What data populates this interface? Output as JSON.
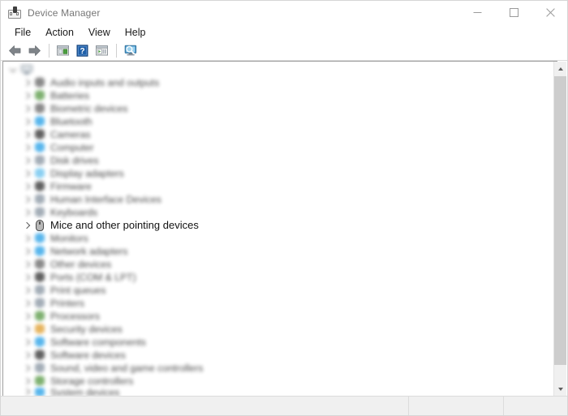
{
  "window": {
    "title": "Device Manager",
    "icon": "device-manager-icon",
    "controls": {
      "minimize": "minimize-icon",
      "maximize": "maximize-icon",
      "close": "close-icon"
    }
  },
  "menubar": {
    "items": [
      {
        "label": "File"
      },
      {
        "label": "Action"
      },
      {
        "label": "View"
      },
      {
        "label": "Help"
      }
    ]
  },
  "toolbar": {
    "buttons": [
      {
        "name": "back-icon",
        "tip": "Back"
      },
      {
        "name": "forward-icon",
        "tip": "Forward"
      },
      {
        "name": "separator-1",
        "tip": ""
      },
      {
        "name": "properties-icon",
        "tip": "Properties"
      },
      {
        "name": "help-icon",
        "tip": "Help"
      },
      {
        "name": "update-driver-icon",
        "tip": "Update driver"
      },
      {
        "name": "separator-2",
        "tip": ""
      },
      {
        "name": "scan-hardware-changes-icon",
        "tip": "Scan for hardware changes"
      }
    ]
  },
  "tree": {
    "root": {
      "label": "",
      "expanded": true,
      "icon": "computer-icon",
      "blurred": true
    },
    "nodes": [
      {
        "label": "Audio inputs and outputs",
        "icon": "audio-icon",
        "color": "gray",
        "blurred": true
      },
      {
        "label": "Batteries",
        "icon": "battery-icon",
        "color": "green",
        "blurred": true
      },
      {
        "label": "Biometric devices",
        "icon": "biometric-icon",
        "color": "gray",
        "blurred": true
      },
      {
        "label": "Bluetooth",
        "icon": "bluetooth-icon",
        "color": "blue",
        "blurred": true
      },
      {
        "label": "Cameras",
        "icon": "camera-icon",
        "color": "dark",
        "blurred": true
      },
      {
        "label": "Computer",
        "icon": "computer-node-icon",
        "color": "blue",
        "blurred": true
      },
      {
        "label": "Disk drives",
        "icon": "disk-drive-icon",
        "color": "steel",
        "blurred": true
      },
      {
        "label": "Display adapters",
        "icon": "display-adapter-icon",
        "color": "lblue",
        "blurred": true
      },
      {
        "label": "Firmware",
        "icon": "firmware-icon",
        "color": "dark",
        "blurred": true
      },
      {
        "label": "Human Interface Devices",
        "icon": "hid-icon",
        "color": "steel",
        "blurred": true
      },
      {
        "label": "Keyboards",
        "icon": "keyboard-icon",
        "color": "steel",
        "blurred": true
      },
      {
        "label": "Mice and other pointing devices",
        "icon": "mouse-icon",
        "color": "dark",
        "blurred": false
      },
      {
        "label": "Monitors",
        "icon": "monitor-icon",
        "color": "blue",
        "blurred": true
      },
      {
        "label": "Network adapters",
        "icon": "network-adapter-icon",
        "color": "blue",
        "blurred": true
      },
      {
        "label": "Other devices",
        "icon": "other-devices-icon",
        "color": "gray",
        "blurred": true
      },
      {
        "label": "Ports (COM & LPT)",
        "icon": "ports-icon",
        "color": "dark",
        "blurred": true
      },
      {
        "label": "Print queues",
        "icon": "print-queue-icon",
        "color": "steel",
        "blurred": true
      },
      {
        "label": "Printers",
        "icon": "printer-icon",
        "color": "steel",
        "blurred": true
      },
      {
        "label": "Processors",
        "icon": "processor-icon",
        "color": "green",
        "blurred": true
      },
      {
        "label": "Security devices",
        "icon": "security-device-icon",
        "color": "orange",
        "blurred": true
      },
      {
        "label": "Software components",
        "icon": "software-component-icon",
        "color": "blue",
        "blurred": true
      },
      {
        "label": "Software devices",
        "icon": "software-device-icon",
        "color": "dark",
        "blurred": true
      },
      {
        "label": "Sound, video and game controllers",
        "icon": "sound-video-game-icon",
        "color": "steel",
        "blurred": true
      },
      {
        "label": "Storage controllers",
        "icon": "storage-controller-icon",
        "color": "green",
        "blurred": true
      },
      {
        "label": "System devices",
        "icon": "system-device-icon",
        "color": "blue",
        "blurred": true
      }
    ]
  },
  "scrollbar": {
    "up_arrow": "scroll-up-icon",
    "down_arrow": "scroll-down-icon"
  },
  "statusbar": {
    "main": "",
    "mid": "",
    "end": ""
  }
}
